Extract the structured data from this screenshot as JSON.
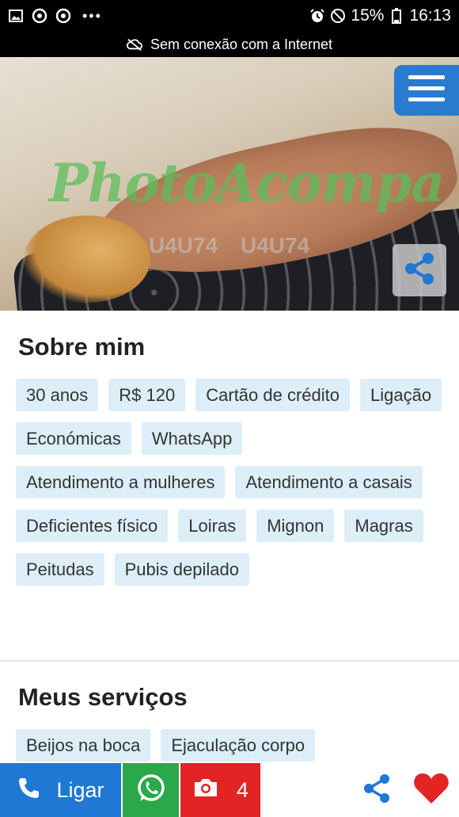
{
  "status_bar": {
    "battery": "15%",
    "time": "16:13",
    "icons": [
      "image-icon",
      "chrome-icon",
      "chrome-icon",
      "more-dots-icon",
      "alarm-icon",
      "do-not-disturb-icon",
      "battery-icon"
    ],
    "more": "•••"
  },
  "offline_banner": {
    "text": "Sem conexão com a Internet",
    "icon": "cloud-off-icon"
  },
  "hero": {
    "watermark": "PhotoAcompa",
    "watermark_code": "U4U74",
    "menu_icon": "hamburger-menu-icon",
    "share_icon": "share-icon"
  },
  "about": {
    "title": "Sobre mim",
    "tags": [
      "30 anos",
      "R$ 120",
      "Cartão de crédito",
      "Ligação",
      "Económicas",
      "WhatsApp",
      "Atendimento a mulheres",
      "Atendimento a casais",
      "Deficientes físico",
      "Loiras",
      "Mignon",
      "Magras",
      "Peitudas",
      "Pubis depilado"
    ]
  },
  "services": {
    "title": "Meus serviços",
    "tags": [
      "Beijos na boca",
      "Ejaculação corpo"
    ]
  },
  "bottom_bar": {
    "call_label": "Ligar",
    "photo_count": "4",
    "colors": {
      "call": "#1e78d4",
      "whatsapp": "#2aa84a",
      "photos": "#e32424",
      "share": "#1e78d4",
      "heart": "#e32424"
    }
  }
}
